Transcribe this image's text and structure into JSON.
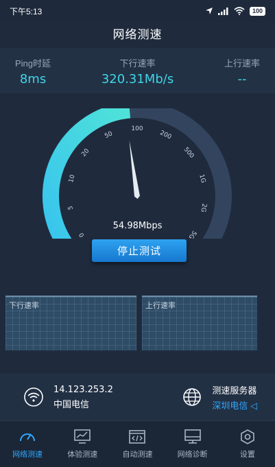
{
  "status_bar": {
    "time": "下午5:13",
    "battery": "100"
  },
  "header": {
    "title": "网络测速"
  },
  "metrics": [
    {
      "label": "Ping时延",
      "value": "8ms"
    },
    {
      "label": "下行速率",
      "value": "320.31Mb/s"
    },
    {
      "label": "上行速率",
      "value": "--"
    }
  ],
  "gauge": {
    "ticks": [
      "0",
      "5",
      "10",
      "20",
      "50",
      "100",
      "200",
      "500",
      "1G",
      "2G",
      "5G"
    ],
    "fill_fraction": 0.48,
    "needle_fraction": 0.5,
    "readout": "54.98Mbps"
  },
  "stop_button": {
    "label": "停止测试"
  },
  "graphs": [
    {
      "label": "下行速率"
    },
    {
      "label": "上行速率"
    }
  ],
  "server": {
    "ip": "14.123.253.2",
    "isp": "中国电信",
    "title": "测速服务器",
    "name": "深圳电信"
  },
  "nav": [
    {
      "label": "网络测速",
      "icon": "gauge-icon",
      "active": true
    },
    {
      "label": "体验测速",
      "icon": "monitor-chart-icon",
      "active": false
    },
    {
      "label": "自动测速",
      "icon": "code-window-icon",
      "active": false
    },
    {
      "label": "网络诊断",
      "icon": "display-icon",
      "active": false
    },
    {
      "label": "设置",
      "icon": "settings-hexagon-icon",
      "active": false
    }
  ],
  "colors": {
    "accent": "#2ea8ff",
    "gauge_fill": "#3fd6e8",
    "gauge_track": "#33455e",
    "background": "#1f2b3d"
  }
}
